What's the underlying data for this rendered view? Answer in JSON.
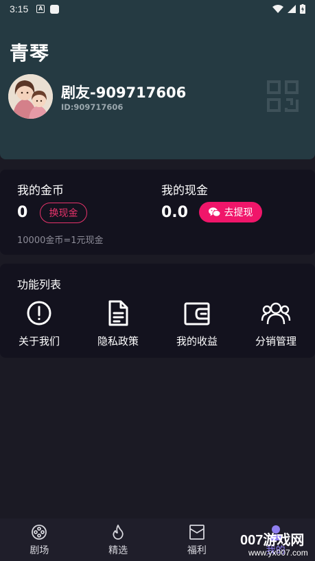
{
  "status_bar": {
    "time": "3:15",
    "notif_a": "A"
  },
  "header": {
    "app_title": "青琴",
    "user_name": "剧友-909717606",
    "user_id": "ID:909717606"
  },
  "wallet": {
    "coins_label": "我的金币",
    "coins_value": "0",
    "exchange_label": "换现金",
    "cash_label": "我的现金",
    "cash_value": "0.0",
    "withdraw_label": "去提现",
    "rate_text": "10000金币=1元现金"
  },
  "features": {
    "title": "功能列表",
    "items": [
      {
        "label": "关于我们",
        "icon": "info-icon"
      },
      {
        "label": "隐私政策",
        "icon": "document-icon"
      },
      {
        "label": "我的收益",
        "icon": "wallet-icon"
      },
      {
        "label": "分销管理",
        "icon": "group-icon"
      }
    ]
  },
  "bottom_nav": {
    "items": [
      {
        "label": "剧场",
        "icon": "film-reel-icon"
      },
      {
        "label": "精选",
        "icon": "flame-icon"
      },
      {
        "label": "福利",
        "icon": "gift-box-icon"
      },
      {
        "label": "我的",
        "icon": "user-icon"
      }
    ],
    "active_index": 3
  },
  "watermark": {
    "text": "007游戏网",
    "sub": "www.yx007.com"
  },
  "colors": {
    "header_bg": "#253a42",
    "page_bg": "#1b1a24",
    "card_bg": "#13121e",
    "accent_pink": "#f0166a",
    "accent_purple": "#8f7ff0"
  }
}
